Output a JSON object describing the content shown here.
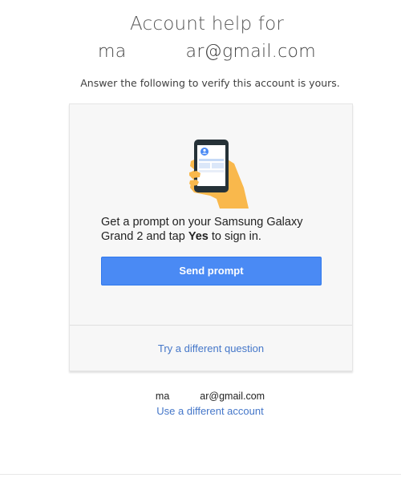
{
  "header": {
    "title": "Account help for",
    "email_prefix": "ma",
    "email_suffix": "ar@gmail.com"
  },
  "subtitle": "Answer the following to verify this account is yours.",
  "card": {
    "illustration_icon": "phone-in-hand-icon",
    "prompt_part1": "Get a prompt on your Samsung Galaxy Grand 2 and tap ",
    "prompt_bold": "Yes",
    "prompt_part2": " to sign in.",
    "send_button_label": "Send prompt",
    "different_question_link": "Try a different question"
  },
  "footer": {
    "email_prefix": "ma",
    "email_suffix": "ar@gmail.com",
    "different_account_link": "Use a different account"
  },
  "colors": {
    "button_bg": "#4a8af4",
    "link": "#4577c9",
    "card_bg": "#f7f7f7",
    "hand": "#f9b84c"
  }
}
